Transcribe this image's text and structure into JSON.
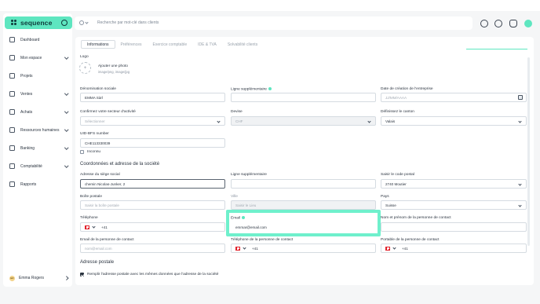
{
  "app": {
    "brand": "sequence",
    "accent_color": "#5ee6c0"
  },
  "sidebar": {
    "items": [
      {
        "label": "Dashboard",
        "icon": "home-icon",
        "has_chevron": false
      },
      {
        "label": "Mon espace",
        "icon": "user-icon",
        "has_chevron": true
      },
      {
        "label": "Projets",
        "icon": "check-square-icon",
        "has_chevron": false
      },
      {
        "label": "Ventes",
        "icon": "coins-icon",
        "has_chevron": true
      },
      {
        "label": "Achats",
        "icon": "tag-icon",
        "has_chevron": true
      },
      {
        "label": "Ressources humaines",
        "icon": "people-icon",
        "has_chevron": true
      },
      {
        "label": "Banking",
        "icon": "bank-icon",
        "has_chevron": true
      },
      {
        "label": "Comptabilité",
        "icon": "calculator-icon",
        "has_chevron": true
      },
      {
        "label": "Rapports",
        "icon": "chart-icon",
        "has_chevron": false
      }
    ],
    "user": {
      "initials": "ER",
      "name": "Emma Rogers"
    }
  },
  "topbar": {
    "search_placeholder": "Recherche par mot-clé dans clients"
  },
  "tabs": [
    "Informations",
    "Préférences",
    "Exercice comptable",
    "IDE & TVA",
    "Solvabilité clients"
  ],
  "form": {
    "logo_label": "Logo",
    "add_photo": "Ajouter une photo",
    "photo_formats": "image/png, image/jpg",
    "denomination_label": "Dénomination sociale",
    "denomination_value": "EMMA Sàrl",
    "extra_line_label": "Ligne supplémentaire",
    "creation_date_label": "Date de création de l'entreprise",
    "creation_date_placeholder": "JJ/MM/AAAA",
    "sector_label": "Confirmez votre secteur d'activité",
    "sector_placeholder": "Sélectionner",
    "currency_label": "Devise",
    "currency_value": "CHF",
    "canton_label": "Définissez le canton",
    "canton_value": "Valais",
    "uid_label": "UID-BFS number",
    "uid_value": "CHE113330039",
    "unknown_label": "Inconnu",
    "address_section": "Coordonnées et adresse de la société",
    "hq_address_label": "Adresse du siège social",
    "hq_address_value": "chemin Nicolas-Junker, 2",
    "extra_line2_label": "Ligne supplémentaire",
    "postal_code_label": "Saisir le code postal",
    "postal_code_value": "2740 Moutier",
    "po_box_label": "Boîte postale",
    "po_box_placeholder": "Saisir la boîte postale",
    "city_label": "Ville",
    "city_placeholder": "Saisir le Lieu",
    "country_label": "Pays",
    "country_value": "Suisse",
    "phone_label": "Téléphone",
    "phone_value": "+41",
    "email_label": "Email",
    "email_value": "emmar@email.com",
    "contact_name_label": "Nom et prénom de la personne de contact",
    "contact_email_label": "Email de la personne de contact",
    "contact_email_placeholder": "nom@email.com",
    "contact_phone_label": "Téléphone de la personne de contact",
    "contact_phone_value": "+41",
    "contact_mobile_label": "Portable de la personne de contact",
    "contact_mobile_value": "+41",
    "postal_section": "Adresse postale",
    "same_address_label": "Remplir l'adresse postale avec les mêmes données que l'adresse de la société"
  }
}
